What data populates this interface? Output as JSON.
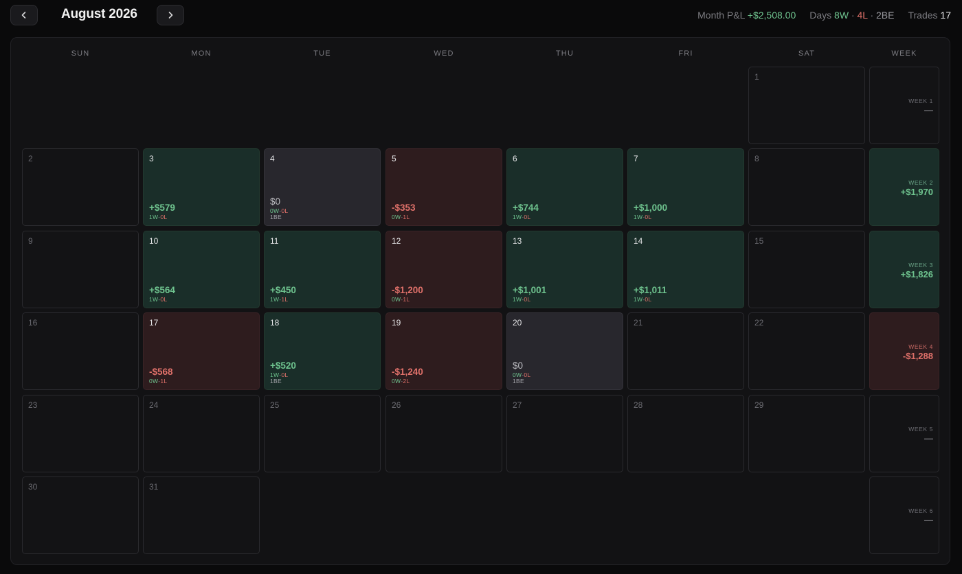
{
  "header": {
    "title": "August 2026",
    "prev_icon": "chevron-left-icon",
    "next_icon": "chevron-right-icon",
    "month_pnl_label": "Month P&L",
    "month_pnl_value": "+$2,508.00",
    "days_label": "Days",
    "days_w": "8W",
    "days_l": "4L",
    "days_be": "2BE",
    "trades_label": "Trades",
    "trades_value": "17",
    "sep": "·"
  },
  "colors": {
    "win": "#6fc48f",
    "loss": "#e0716a",
    "win_bg": "#1a2e29",
    "loss_bg": "#2e1c1e",
    "be_bg": "#28272d"
  },
  "weekdays": [
    "SUN",
    "MON",
    "TUE",
    "WED",
    "THU",
    "FRI",
    "SAT",
    "WEEK"
  ],
  "days": [
    {
      "day": "1",
      "row": 0,
      "col": 6
    },
    {
      "day": "2",
      "row": 1,
      "col": 0
    },
    {
      "day": "3",
      "row": 1,
      "col": 1,
      "status": "win",
      "pnl": "+$579",
      "w": "1W",
      "l": "0L"
    },
    {
      "day": "4",
      "row": 1,
      "col": 2,
      "status": "be",
      "pnl": "$0",
      "w": "0W",
      "l": "0L",
      "be": "1BE"
    },
    {
      "day": "5",
      "row": 1,
      "col": 3,
      "status": "loss",
      "pnl": "-$353",
      "w": "0W",
      "l": "1L"
    },
    {
      "day": "6",
      "row": 1,
      "col": 4,
      "status": "win",
      "pnl": "+$744",
      "w": "1W",
      "l": "0L"
    },
    {
      "day": "7",
      "row": 1,
      "col": 5,
      "status": "win",
      "pnl": "+$1,000",
      "w": "1W",
      "l": "0L"
    },
    {
      "day": "8",
      "row": 1,
      "col": 6
    },
    {
      "day": "9",
      "row": 2,
      "col": 0
    },
    {
      "day": "10",
      "row": 2,
      "col": 1,
      "status": "win",
      "pnl": "+$564",
      "w": "1W",
      "l": "0L"
    },
    {
      "day": "11",
      "row": 2,
      "col": 2,
      "status": "win",
      "pnl": "+$450",
      "w": "1W",
      "l": "1L"
    },
    {
      "day": "12",
      "row": 2,
      "col": 3,
      "status": "loss",
      "pnl": "-$1,200",
      "w": "0W",
      "l": "1L"
    },
    {
      "day": "13",
      "row": 2,
      "col": 4,
      "status": "win",
      "pnl": "+$1,001",
      "w": "1W",
      "l": "0L"
    },
    {
      "day": "14",
      "row": 2,
      "col": 5,
      "status": "win",
      "pnl": "+$1,011",
      "w": "1W",
      "l": "0L"
    },
    {
      "day": "15",
      "row": 2,
      "col": 6
    },
    {
      "day": "16",
      "row": 3,
      "col": 0
    },
    {
      "day": "17",
      "row": 3,
      "col": 1,
      "status": "loss",
      "pnl": "-$568",
      "w": "0W",
      "l": "1L"
    },
    {
      "day": "18",
      "row": 3,
      "col": 2,
      "status": "win",
      "pnl": "+$520",
      "w": "1W",
      "l": "0L",
      "be": "1BE"
    },
    {
      "day": "19",
      "row": 3,
      "col": 3,
      "status": "loss",
      "pnl": "-$1,240",
      "w": "0W",
      "l": "2L"
    },
    {
      "day": "20",
      "row": 3,
      "col": 4,
      "status": "be",
      "pnl": "$0",
      "w": "0W",
      "l": "0L",
      "be": "1BE"
    },
    {
      "day": "21",
      "row": 3,
      "col": 5
    },
    {
      "day": "22",
      "row": 3,
      "col": 6
    },
    {
      "day": "23",
      "row": 4,
      "col": 0
    },
    {
      "day": "24",
      "row": 4,
      "col": 1
    },
    {
      "day": "25",
      "row": 4,
      "col": 2
    },
    {
      "day": "26",
      "row": 4,
      "col": 3
    },
    {
      "day": "27",
      "row": 4,
      "col": 4
    },
    {
      "day": "28",
      "row": 4,
      "col": 5
    },
    {
      "day": "29",
      "row": 4,
      "col": 6
    },
    {
      "day": "30",
      "row": 5,
      "col": 0
    },
    {
      "day": "31",
      "row": 5,
      "col": 1
    }
  ],
  "weeks": [
    {
      "label": "WEEK 1",
      "value": "—",
      "status": "none"
    },
    {
      "label": "WEEK 2",
      "value": "+$1,970",
      "status": "win"
    },
    {
      "label": "WEEK 3",
      "value": "+$1,826",
      "status": "win"
    },
    {
      "label": "WEEK 4",
      "value": "-$1,288",
      "status": "loss"
    },
    {
      "label": "WEEK 5",
      "value": "—",
      "status": "none"
    },
    {
      "label": "WEEK 6",
      "value": "—",
      "status": "none"
    }
  ]
}
